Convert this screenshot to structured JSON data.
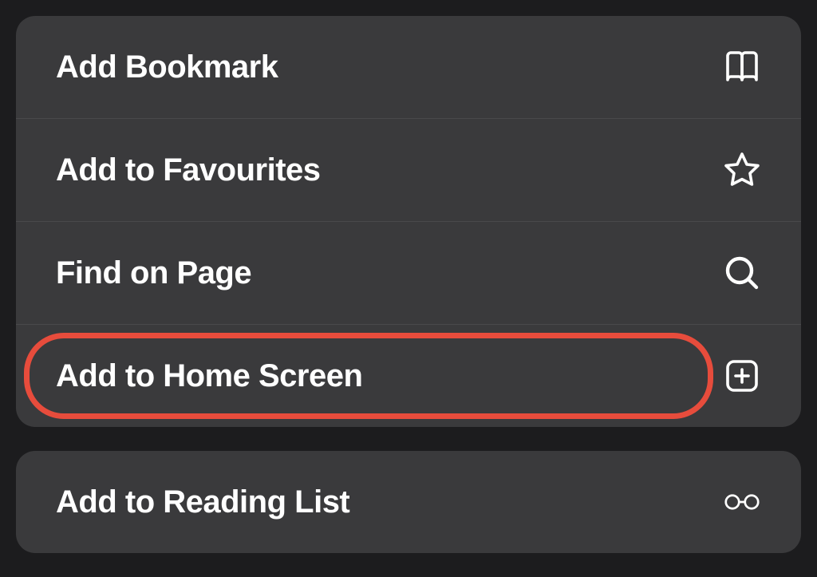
{
  "menu": {
    "group1": [
      {
        "label": "Add Bookmark",
        "icon": "book-icon",
        "name": "add-bookmark-item"
      },
      {
        "label": "Add to Favourites",
        "icon": "star-icon",
        "name": "add-to-favourites-item"
      },
      {
        "label": "Find on Page",
        "icon": "search-icon",
        "name": "find-on-page-item"
      },
      {
        "label": "Add to Home Screen",
        "icon": "plus-square-icon",
        "name": "add-to-home-screen-item",
        "highlighted": true
      }
    ],
    "group2": [
      {
        "label": "Add to Reading List",
        "icon": "glasses-icon",
        "name": "add-to-reading-list-item"
      }
    ]
  },
  "highlight_color": "#e74c3c"
}
